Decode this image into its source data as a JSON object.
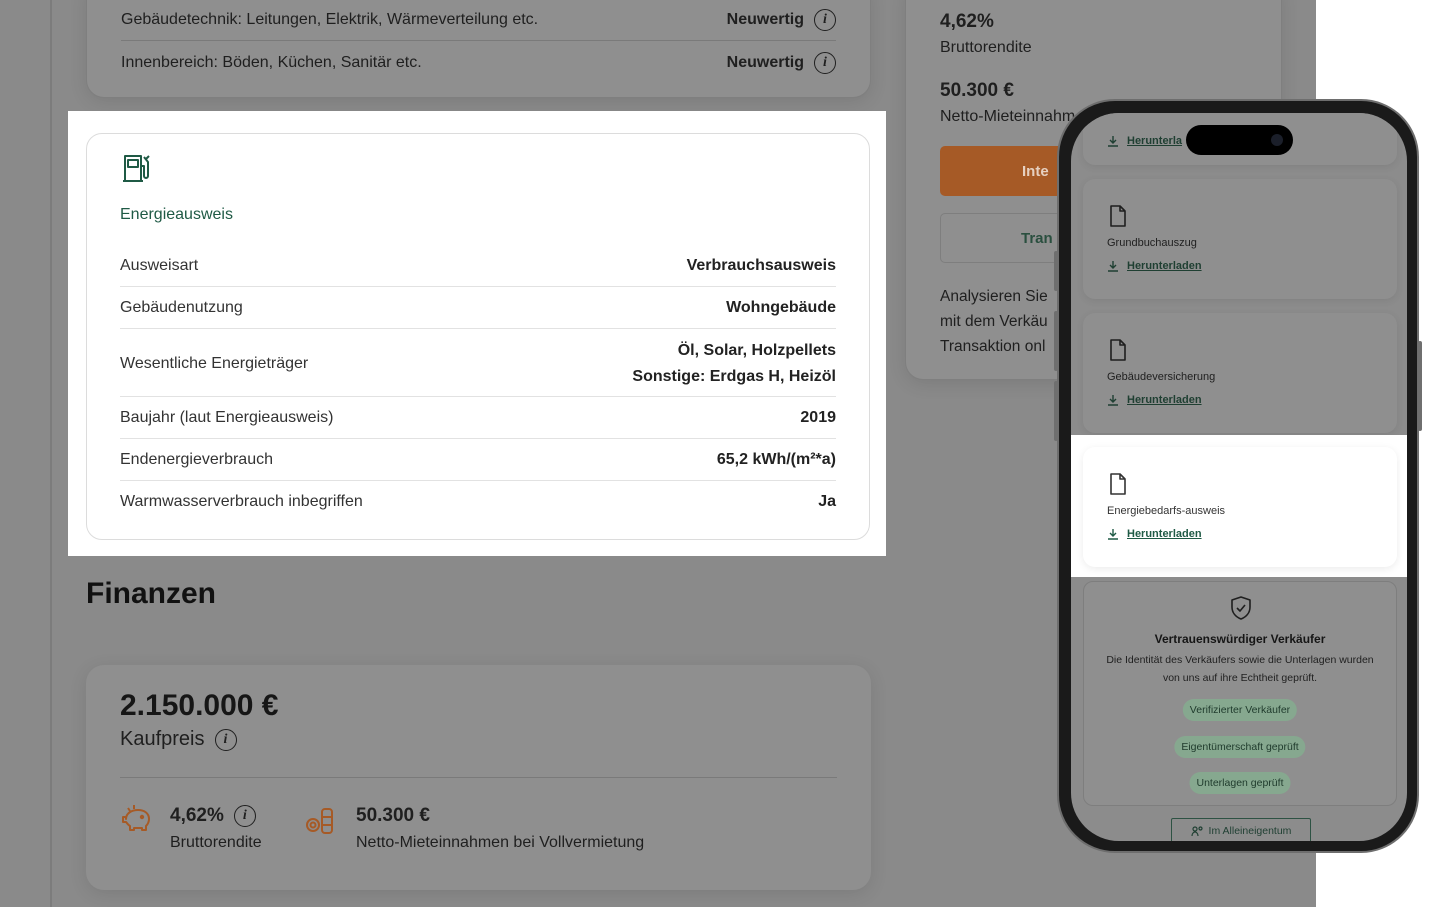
{
  "building_details": {
    "rows": [
      {
        "label": "Gebäudetechnik: Leitungen, Elektrik, Wärmeverteilung etc.",
        "value": "Neuwertig"
      },
      {
        "label": "Innenbereich: Böden, Küchen, Sanitär etc.",
        "value": "Neuwertig"
      }
    ]
  },
  "energy_card": {
    "icon": "fuel-pump-icon",
    "title": "Energieausweis",
    "rows": [
      {
        "label": "Ausweisart",
        "value": "Verbrauchsausweis"
      },
      {
        "label": "Gebäudenutzung",
        "value": "Wohngebäude"
      },
      {
        "label": "Wesentliche Energieträger",
        "value_line1": "Öl, Solar, Holzpellets",
        "value_line2": "Sonstige: Erdgas H, Heizöl"
      },
      {
        "label": "Baujahr (laut Energieausweis)",
        "value": "2019"
      },
      {
        "label": "Endenergieverbrauch",
        "value": "65,2 kWh/(m²*a)"
      },
      {
        "label": "Warmwasserverbrauch inbegriffen",
        "value": "Ja"
      }
    ],
    "accent_color": "#1f5a45"
  },
  "right_card": {
    "yield_value": "4,62%",
    "yield_label": "Bruttorendite",
    "rent_value": "50.300 €",
    "rent_label": "Netto-Mieteinnahm",
    "primary_button": "Inte",
    "secondary_button": "Tran",
    "text_lines": [
      "Analysieren Sie",
      "mit dem Verkäu",
      "Transaktion onl"
    ],
    "button_color": "#a65a26"
  },
  "finance": {
    "heading": "Finanzen",
    "price": "2.150.000 €",
    "price_label": "Kaufpreis",
    "stats": [
      {
        "icon": "piggy-bank-icon",
        "value": "4,62%",
        "label": "Bruttorendite"
      },
      {
        "icon": "coins-icon",
        "value": "50.300 €",
        "label": "Netto-Mieteinnahmen bei Vollvermietung"
      }
    ]
  },
  "phone": {
    "documents": [
      {
        "title": "",
        "link": "Herunterla"
      },
      {
        "title": "Grundbuchauszug",
        "link": "Herunterladen"
      },
      {
        "title": "Gebäudeversicherung",
        "link": "Herunterladen"
      },
      {
        "title": "Energiebedarfs-ausweis",
        "link": "Herunterladen"
      }
    ],
    "trust": {
      "title": "Vertrauenswürdiger Verkäufer",
      "text": "Die Identität des Verkäufers sowie die Unterlagen wurden von uns auf ihre Echtheit geprüft.",
      "badges": [
        "Verifizierter Verkäufer",
        "Eigentümerschaft geprüft",
        "Unterlagen geprüft"
      ]
    },
    "owner_button": "Im Alleineigentum"
  }
}
